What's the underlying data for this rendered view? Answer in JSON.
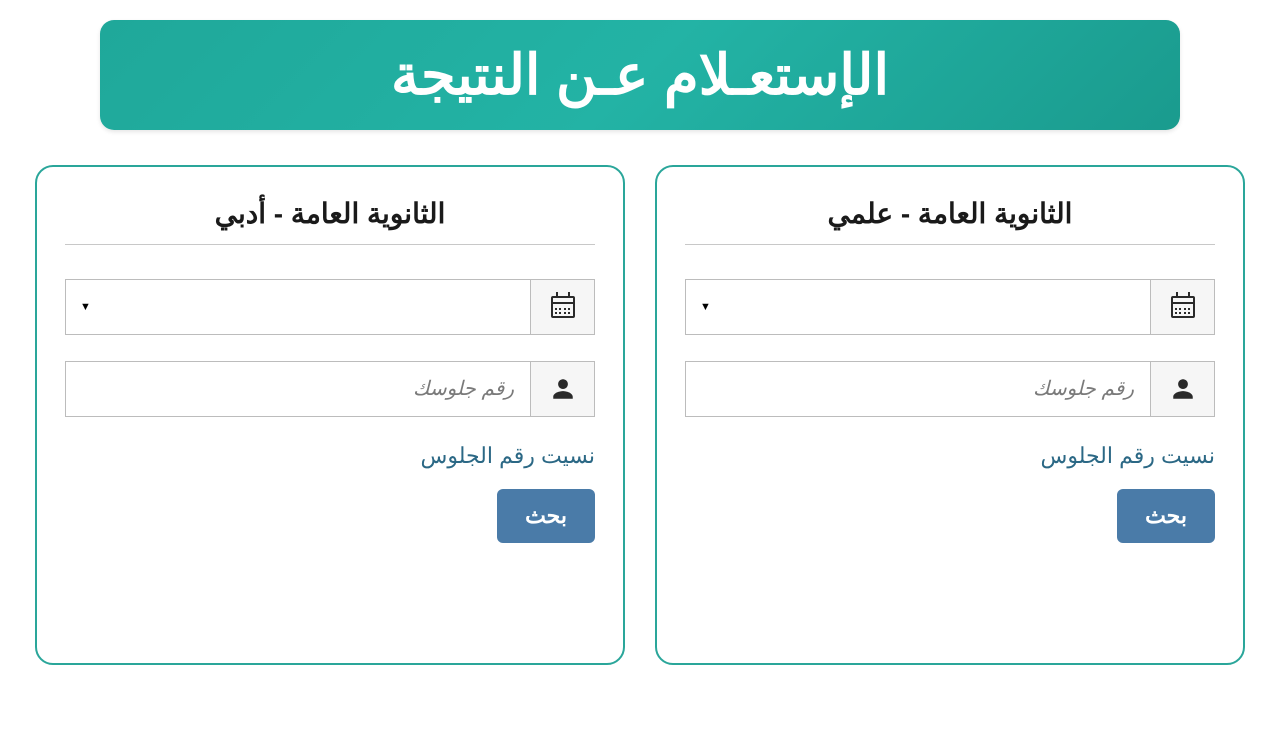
{
  "header": {
    "title": "الإستعـلام عـن النتيجة"
  },
  "panels": {
    "science": {
      "title": "الثانوية العامة - علمي",
      "seat_placeholder": "رقم جلوسك",
      "forgot_link": "نسيت رقم الجلوس",
      "search_button": "بحث"
    },
    "arts": {
      "title": "الثانوية العامة - أدبي",
      "seat_placeholder": "رقم جلوسك",
      "forgot_link": "نسيت رقم الجلوس",
      "search_button": "بحث"
    }
  }
}
